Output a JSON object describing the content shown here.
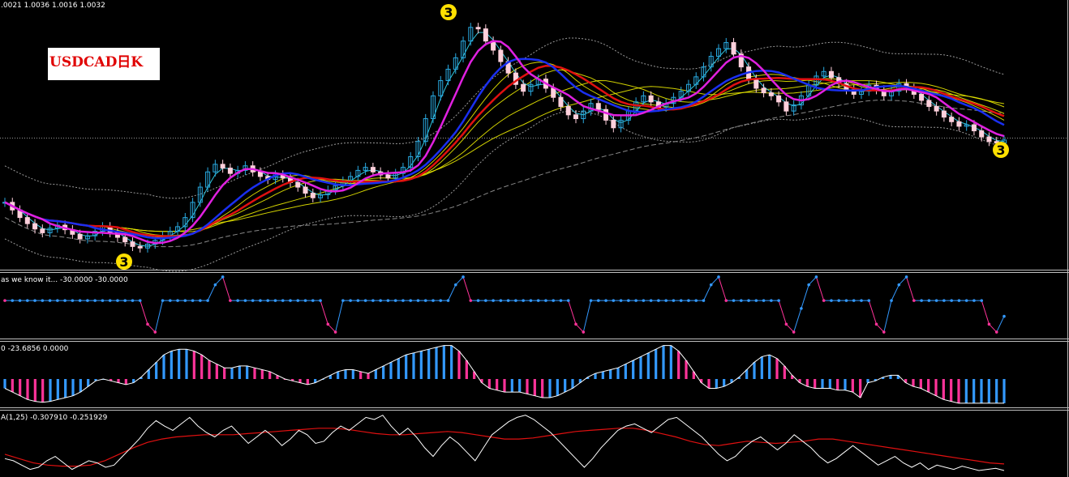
{
  "headers": {
    "price": ".0021 1.0036 1.0016 1.0032",
    "ind1": "as we know it...  -30.0000 -30.0000",
    "ind2": "0 -23.6856 0.0000",
    "ind3": "A(1,25) -0.307910 -0.251929"
  },
  "title_label": "USDCAD日K",
  "wave_labels": [
    {
      "text": "3",
      "style": "big"
    },
    {
      "text": "3",
      "style": "big"
    },
    {
      "text": "3",
      "style": "big"
    }
  ],
  "colors": {
    "background": "#000000",
    "bull_candle": "#29a9e0",
    "bear_candle": "#ffd0dc",
    "ma_fast": "#e020e0",
    "ma_mid": "#1a2ff0",
    "ma_slow": "#e01010",
    "ma_yellow": "#e8e800",
    "ma_cyan": "#30c8e0",
    "band": "#9a9a9a",
    "bar_up": "#3399ff",
    "bar_down": "#ff3399",
    "panel_border": "#bfbfbf"
  },
  "chart_data": [
    {
      "type": "candlestick",
      "title": "USDCAD日K",
      "series": [
        {
          "name": "close",
          "values": [
            1.005,
            1.004,
            1.003,
            1.0022,
            1.0015,
            1.001,
            1.0016,
            1.002,
            1.0014,
            1.0008,
            1.0002,
            1.0006,
            1.0012,
            1.0018,
            1.001,
            1.0004,
            0.9998,
            0.9992,
            0.999,
            0.9995,
            1.0,
            1.0006,
            1.0012,
            1.0018,
            1.003,
            1.005,
            1.007,
            1.009,
            1.01,
            1.0095,
            1.0088,
            1.0092,
            1.0098,
            1.009,
            1.0084,
            1.008,
            1.0086,
            1.0082,
            1.0076,
            1.007,
            1.0062,
            1.0056,
            1.006,
            1.0066,
            1.0072,
            1.0078,
            1.0084,
            1.0092,
            1.0096,
            1.009,
            1.0086,
            1.0082,
            1.0088,
            1.0096,
            1.011,
            1.013,
            1.016,
            1.019,
            1.021,
            1.0225,
            1.024,
            1.0262,
            1.028,
            1.0278,
            1.0262,
            1.025,
            1.0235,
            1.022,
            1.0205,
            1.0196,
            1.0205,
            1.0212,
            1.02,
            1.0188,
            1.0176,
            1.0165,
            1.016,
            1.017,
            1.018,
            1.0172,
            1.0158,
            1.0148,
            1.0158,
            1.017,
            1.0182,
            1.019,
            1.0182,
            1.0175,
            1.018,
            1.0188,
            1.0196,
            1.0205,
            1.0215,
            1.0228,
            1.0242,
            1.0252,
            1.026,
            1.0245,
            1.0228,
            1.0212,
            1.02,
            1.0194,
            1.019,
            1.0182,
            1.017,
            1.0178,
            1.019,
            1.0204,
            1.0216,
            1.0222,
            1.0214,
            1.0206,
            1.0198,
            1.0192,
            1.0196,
            1.0204,
            1.0198,
            1.019,
            1.0196,
            1.0206,
            1.02,
            1.0192,
            1.0184,
            1.0176,
            1.017,
            1.0162,
            1.0156,
            1.015,
            1.0152,
            1.0144,
            1.0136,
            1.013,
            1.0128,
            1.0132
          ]
        }
      ]
    },
    {
      "type": "line",
      "title": "as we know it...",
      "series": [
        {
          "name": "oscillator",
          "values": [
            -30,
            -30,
            -30,
            -30,
            -30,
            -30,
            -30,
            -30,
            -30,
            -30,
            -30,
            -30,
            -30,
            -30,
            -30,
            -30,
            -30,
            -30,
            -30,
            -60,
            -70,
            -30,
            -30,
            -30,
            -30,
            -30,
            -30,
            -30,
            -10,
            0,
            -30,
            -30,
            -30,
            -30,
            -30,
            -30,
            -30,
            -30,
            -30,
            -30,
            -30,
            -30,
            -30,
            -60,
            -70,
            -30,
            -30,
            -30,
            -30,
            -30,
            -30,
            -30,
            -30,
            -30,
            -30,
            -30,
            -30,
            -30,
            -30,
            -30,
            -10,
            0,
            -30,
            -30,
            -30,
            -30,
            -30,
            -30,
            -30,
            -30,
            -30,
            -30,
            -30,
            -30,
            -30,
            -30,
            -60,
            -70,
            -30,
            -30,
            -30,
            -30,
            -30,
            -30,
            -30,
            -30,
            -30,
            -30,
            -30,
            -30,
            -30,
            -30,
            -30,
            -30,
            -10,
            0,
            -30,
            -30,
            -30,
            -30,
            -30,
            -30,
            -30,
            -30,
            -60,
            -70,
            -40,
            -10,
            0,
            -30,
            -30,
            -30,
            -30,
            -30,
            -30,
            -30,
            -60,
            -70,
            -30,
            -10,
            0,
            -30,
            -30,
            -30,
            -30,
            -30,
            -30,
            -30,
            -30,
            -30,
            -30,
            -60,
            -70,
            -50
          ]
        }
      ]
    },
    {
      "type": "bar",
      "title": "",
      "series": [
        {
          "name": "histogram",
          "values": [
            -10,
            -14,
            -18,
            -22,
            -24,
            -25,
            -24,
            -22,
            -20,
            -18,
            -14,
            -8,
            -2,
            0,
            -2,
            -4,
            -6,
            -4,
            2,
            10,
            18,
            26,
            30,
            32,
            32,
            30,
            26,
            20,
            16,
            12,
            12,
            14,
            14,
            12,
            10,
            8,
            4,
            0,
            -2,
            -4,
            -6,
            -4,
            0,
            4,
            8,
            10,
            10,
            8,
            6,
            10,
            14,
            18,
            22,
            26,
            28,
            30,
            32,
            34,
            36,
            36,
            30,
            20,
            8,
            -4,
            -10,
            -12,
            -14,
            -14,
            -14,
            -16,
            -18,
            -20,
            -20,
            -18,
            -14,
            -10,
            -4,
            2,
            6,
            8,
            10,
            12,
            16,
            20,
            24,
            28,
            32,
            36,
            36,
            30,
            20,
            8,
            -4,
            -10,
            -10,
            -8,
            -4,
            2,
            10,
            18,
            24,
            26,
            22,
            14,
            4,
            -4,
            -8,
            -10,
            -10,
            -10,
            -12,
            -12,
            -14,
            -20,
            -4,
            -2,
            2,
            4,
            4,
            -4,
            -8,
            -10,
            -14,
            -18,
            -22,
            -24,
            -26,
            -26,
            -26,
            -26,
            -26,
            -26,
            -26
          ]
        }
      ]
    },
    {
      "type": "line",
      "title": "A(1,25)",
      "series": [
        {
          "name": "line",
          "values": [
            -0.2,
            -0.22,
            -0.26,
            -0.3,
            -0.28,
            -0.22,
            -0.18,
            -0.24,
            -0.3,
            -0.26,
            -0.22,
            -0.24,
            -0.28,
            -0.26,
            -0.18,
            -0.1,
            -0.02,
            0.08,
            0.15,
            0.1,
            0.06,
            0.12,
            0.18,
            0.1,
            0.04,
            0.0,
            0.06,
            0.1,
            0.02,
            -0.06,
            0.0,
            0.06,
            0.0,
            -0.08,
            -0.02,
            0.06,
            0.02,
            -0.06,
            -0.04,
            0.04,
            0.1,
            0.06,
            0.12,
            0.18,
            0.16,
            0.2,
            0.1,
            0.02,
            0.08,
            0.0,
            -0.1,
            -0.18,
            -0.08,
            0.0,
            -0.06,
            -0.14,
            -0.22,
            -0.1,
            0.02,
            0.08,
            0.14,
            0.18,
            0.2,
            0.16,
            0.1,
            0.04,
            -0.04,
            -0.12,
            -0.2,
            -0.28,
            -0.2,
            -0.1,
            -0.02,
            0.06,
            0.1,
            0.12,
            0.08,
            0.04,
            0.1,
            0.16,
            0.18,
            0.12,
            0.06,
            0.0,
            -0.08,
            -0.16,
            -0.22,
            -0.18,
            -0.1,
            -0.04,
            0.0,
            -0.06,
            -0.12,
            -0.06,
            0.02,
            -0.04,
            -0.1,
            -0.18,
            -0.24,
            -0.2,
            -0.14,
            -0.08,
            -0.14,
            -0.2,
            -0.26,
            -0.22,
            -0.18,
            -0.24,
            -0.28,
            -0.24,
            -0.3,
            -0.26,
            -0.28,
            -0.3,
            -0.27,
            -0.29,
            -0.31,
            -0.3,
            -0.29,
            -0.31
          ]
        },
        {
          "name": "signal",
          "values": [
            -0.16,
            -0.2,
            -0.24,
            -0.26,
            -0.27,
            -0.27,
            -0.26,
            -0.22,
            -0.16,
            -0.1,
            -0.05,
            -0.02,
            0.0,
            0.01,
            0.02,
            0.02,
            0.02,
            0.03,
            0.04,
            0.05,
            0.06,
            0.07,
            0.08,
            0.08,
            0.07,
            0.05,
            0.03,
            0.02,
            0.02,
            0.03,
            0.04,
            0.05,
            0.04,
            0.02,
            0.0,
            -0.02,
            -0.02,
            -0.01,
            0.01,
            0.03,
            0.05,
            0.06,
            0.07,
            0.08,
            0.08,
            0.06,
            0.03,
            0.0,
            -0.04,
            -0.07,
            -0.08,
            -0.06,
            -0.04,
            -0.05,
            -0.06,
            -0.05,
            -0.04,
            -0.02,
            -0.02,
            -0.04,
            -0.06,
            -0.08,
            -0.1,
            -0.12,
            -0.14,
            -0.16,
            -0.18,
            -0.2,
            -0.22,
            -0.24,
            -0.25
          ]
        }
      ]
    }
  ]
}
